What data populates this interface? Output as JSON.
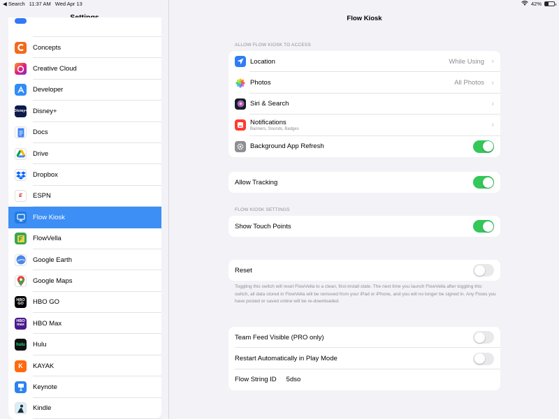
{
  "status_bar": {
    "back": "◀ Search",
    "time": "11:37 AM",
    "date": "Wed Apr 13",
    "battery": "42%",
    "battery_level": 0.42
  },
  "sidebar": {
    "title": "Settings",
    "items": [
      {
        "label": "",
        "icon": "blue-app-icon",
        "color": "#3478f6"
      },
      {
        "label": "Concepts",
        "icon": "concepts-icon",
        "color": "#f36a1c"
      },
      {
        "label": "Creative Cloud",
        "icon": "creative-cloud-icon",
        "color": "#da1f26"
      },
      {
        "label": "Developer",
        "icon": "developer-icon",
        "color": "#2f8df5"
      },
      {
        "label": "Disney+",
        "icon": "disney-plus-icon",
        "color": "#0d1a4a"
      },
      {
        "label": "Docs",
        "icon": "docs-icon",
        "color": "#ffffff"
      },
      {
        "label": "Drive",
        "icon": "drive-icon",
        "color": "#ffffff"
      },
      {
        "label": "Dropbox",
        "icon": "dropbox-icon",
        "color": "#ffffff"
      },
      {
        "label": "ESPN",
        "icon": "espn-icon",
        "color": "#ffffff"
      },
      {
        "label": "Flow Kiosk",
        "icon": "flow-kiosk-icon",
        "color": "#1f7ae0"
      },
      {
        "label": "FlowVella",
        "icon": "flowvella-icon",
        "color": "#3aa655"
      },
      {
        "label": "Google Earth",
        "icon": "google-earth-icon",
        "color": "#ffffff"
      },
      {
        "label": "Google Maps",
        "icon": "google-maps-icon",
        "color": "#ffffff"
      },
      {
        "label": "HBO GO",
        "icon": "hbo-go-icon",
        "color": "#000000"
      },
      {
        "label": "HBO Max",
        "icon": "hbo-max-icon",
        "color": "#4a1a8c"
      },
      {
        "label": "Hulu",
        "icon": "hulu-icon",
        "color": "#111111"
      },
      {
        "label": "KAYAK",
        "icon": "kayak-icon",
        "color": "#ff690f"
      },
      {
        "label": "Keynote",
        "icon": "keynote-icon",
        "color": "#2a83f0"
      },
      {
        "label": "Kindle",
        "icon": "kindle-icon",
        "color": "#ffffff"
      }
    ],
    "selected": "Flow Kiosk"
  },
  "main": {
    "title": "Flow Kiosk",
    "access_header": "ALLOW FLOW KIOSK TO ACCESS",
    "access_rows": [
      {
        "label": "Location",
        "value": "While Using",
        "icon": "location-arrow-icon",
        "color": "#2f7cf6"
      },
      {
        "label": "Photos",
        "value": "All Photos",
        "icon": "photos-icon",
        "color": "#ffffff"
      },
      {
        "label": "Siri & Search",
        "value": "",
        "icon": "siri-icon",
        "color": "#1c1c1e"
      },
      {
        "label": "Notifications",
        "sub": "Banners, Sounds, Badges",
        "value": "",
        "icon": "notifications-icon",
        "color": "#ff3b30"
      },
      {
        "label": "Background App Refresh",
        "icon": "gear-icon",
        "color": "#8e8e93",
        "toggle": true
      }
    ],
    "tracking": {
      "label": "Allow Tracking",
      "toggle": true
    },
    "settings_header": "FLOW KIOSK SETTINGS",
    "touch_points": {
      "label": "Show Touch Points",
      "toggle": true
    },
    "reset": {
      "label": "Reset",
      "toggle": false
    },
    "reset_footnote": "Toggling this switch will reset FlowVella to a clean, first-install state. The next time you launch FlowVella after toggling this switch, all data stored in FlowVella will be removed from your iPad or iPhone, and you will no longer be signed in. Any Flows you have posted or saved online will be re-downloaded.",
    "team_feed": {
      "label": "Team Feed Visible (PRO only)",
      "toggle": false
    },
    "restart": {
      "label": "Restart Automatically in Play Mode",
      "toggle": false
    },
    "flow_string": {
      "label": "Flow String ID",
      "value": "5dso"
    }
  }
}
